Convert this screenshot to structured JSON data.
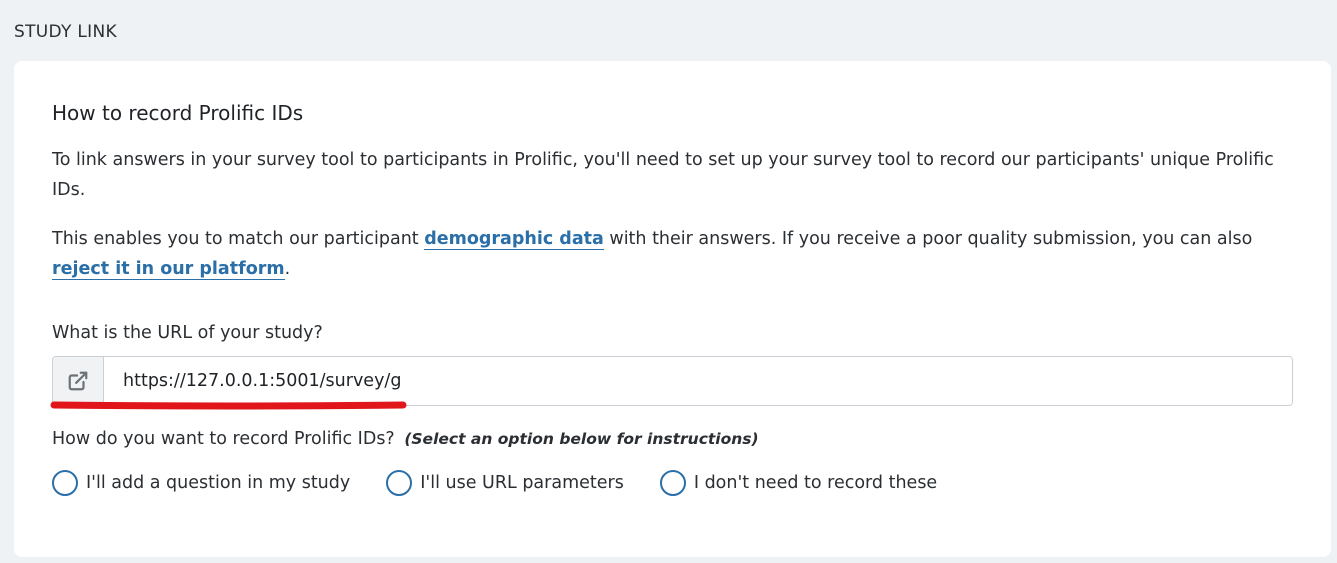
{
  "section": {
    "title": "STUDY LINK"
  },
  "card": {
    "heading": "How to record Prolific IDs",
    "intro": "To link answers in your survey tool to participants in Prolific, you'll need to set up your survey tool to record our participants' unique Prolific IDs.",
    "match_text_before": "This enables you to match our participant ",
    "demographic_link": "demographic data",
    "match_text_middle": " with their answers. If you receive a poor quality submission, you can also ",
    "reject_link": "reject it in our platform",
    "match_text_after": "."
  },
  "url_field": {
    "label": "What is the URL of your study?",
    "value": "https://127.0.0.1:5001/survey/g",
    "icon": "external-link-icon",
    "annotation_color": "#e0161b"
  },
  "record": {
    "label": "How do you want to record Prolific IDs?",
    "hint": "(Select an option below for instructions)",
    "options": [
      {
        "label": "I'll add a question in my study"
      },
      {
        "label": "I'll use URL parameters"
      },
      {
        "label": "I don't need to record these"
      }
    ]
  },
  "colors": {
    "link": "#2a6fa8",
    "background": "#eef2f4",
    "card": "#ffffff"
  }
}
